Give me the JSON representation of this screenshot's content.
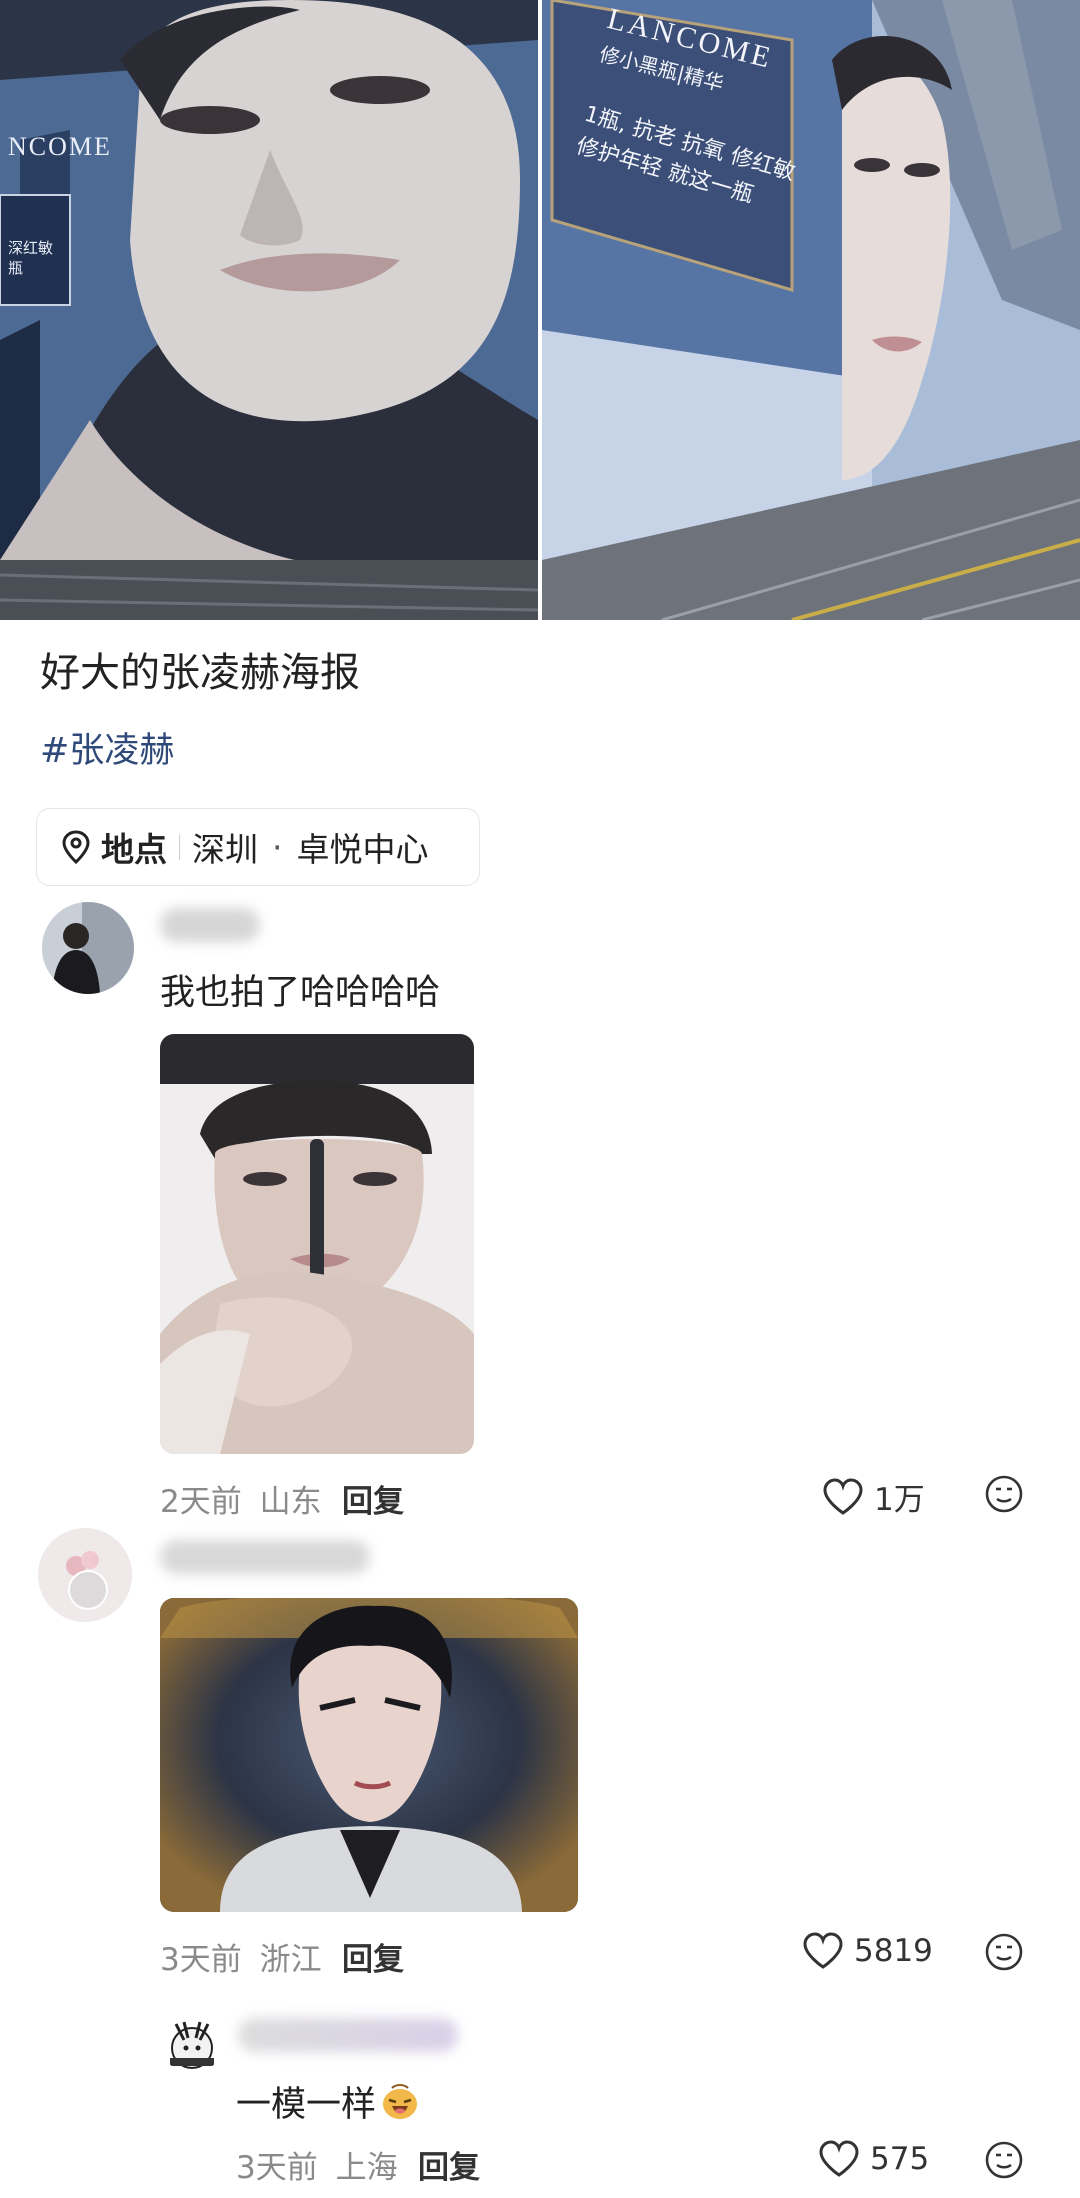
{
  "post": {
    "title": "好大的张凌赫海报",
    "hashtag": "#张凌赫",
    "location": {
      "label": "地点",
      "city": "深圳",
      "dot": "·",
      "place": "卓悦中心"
    },
    "left_photo": {
      "brand_text": "NCOME",
      "panel_text": "深红敏\n瓶"
    },
    "right_photo": {
      "brand_text": "LANCOME",
      "sub_text": "修小黑瓶|精华",
      "ad_line1": "1瓶, 抗老 抗氧 修红敏",
      "ad_line2": "修护年轻 就这一瓶"
    }
  },
  "comments": [
    {
      "text": "我也拍了哈哈哈哈",
      "meta_time": "2天前",
      "meta_region": "山东",
      "reply_label": "回复",
      "likes": "1万"
    },
    {
      "text": "",
      "meta_time": "3天前",
      "meta_region": "浙江",
      "reply_label": "回复",
      "likes": "5819"
    },
    {
      "text": "一模一样",
      "meta_time": "3天前",
      "meta_region": "上海",
      "reply_label": "回复",
      "likes": "575"
    }
  ],
  "colors": {
    "hashtag": "#2f4a7a",
    "meta": "#8a8a8a",
    "text": "#222222"
  }
}
